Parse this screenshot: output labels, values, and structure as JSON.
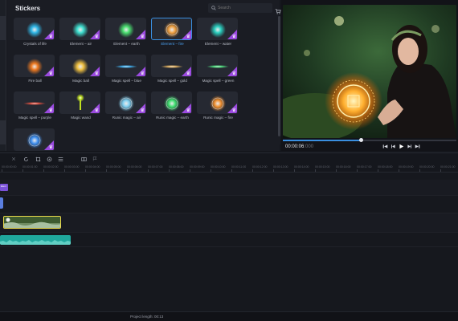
{
  "panel": {
    "title": "Stickers",
    "search_placeholder": "Search"
  },
  "stickers": [
    {
      "label": "Crystals of life",
      "icon": "crystal-icon",
      "color": "#2fb8e8"
    },
    {
      "label": "Element – air",
      "icon": "air-orb-icon",
      "color": "#3ee0d0"
    },
    {
      "label": "Element – earth",
      "icon": "earth-orb-icon",
      "color": "#4ae070"
    },
    {
      "label": "Element – fire",
      "icon": "fire-rune-icon",
      "color": "#f0a040",
      "selected": true
    },
    {
      "label": "Element – water",
      "icon": "water-orb-icon",
      "color": "#2ad0c0"
    },
    {
      "label": "Fire ball",
      "icon": "fireball-icon",
      "color": "#f07a20"
    },
    {
      "label": "Magic ball",
      "icon": "magic-ball-icon",
      "color": "#f0c040"
    },
    {
      "label": "Magic spell – blue",
      "icon": "spell-blue-icon",
      "color": "#40b0f0"
    },
    {
      "label": "Magic spell – gold",
      "icon": "spell-gold-icon",
      "color": "#e0b060"
    },
    {
      "label": "Magic spell – green",
      "icon": "spell-green-icon",
      "color": "#50e080"
    },
    {
      "label": "Magic spell – purple",
      "icon": "spell-purple-icon",
      "color": "#e05040"
    },
    {
      "label": "Magic wand",
      "icon": "magic-wand-icon",
      "color": "#c0e020"
    },
    {
      "label": "Runic magic – air",
      "icon": "rune-air-icon",
      "color": "#80d0f0"
    },
    {
      "label": "Runic magic – earth",
      "icon": "rune-earth-icon",
      "color": "#40e070"
    },
    {
      "label": "Runic magic – fire",
      "icon": "rune-fire-icon",
      "color": "#f09030"
    },
    {
      "label": "",
      "icon": "rune-water-icon",
      "color": "#4090f0"
    }
  ],
  "player": {
    "timecode": "00:00:06",
    "timecode_frames": ":000",
    "progress": 0.45
  },
  "ruler_labels": [
    "00:00:00:00",
    "00:00:01:00",
    "00:00:02:00",
    "00:00:03:00",
    "00:00:04:00",
    "00:00:05:00",
    "00:00:06:00",
    "00:00:07:00",
    "00:00:08:00",
    "00:00:09:00",
    "00:00:10:00",
    "00:00:11:00",
    "00:00:12:00",
    "00:00:13:00",
    "00:00:14:00",
    "00:00:15:00",
    "00:00:16:00",
    "00:00:17:00",
    "00:00:18:00",
    "00:00:19:00",
    "00:00:20:00",
    "00:00:21:00"
  ],
  "timeline": {
    "sticker_clip_label": "Elem"
  },
  "status": {
    "project_length": "Project length: 00:13"
  },
  "colors": {
    "accent": "#3a8fe0",
    "sticker_badge": "#9b4ae0",
    "video_clip_border": "#e9d94a",
    "audio_clip": "#1fa79c",
    "sticker_clip": "#7b52d8"
  }
}
